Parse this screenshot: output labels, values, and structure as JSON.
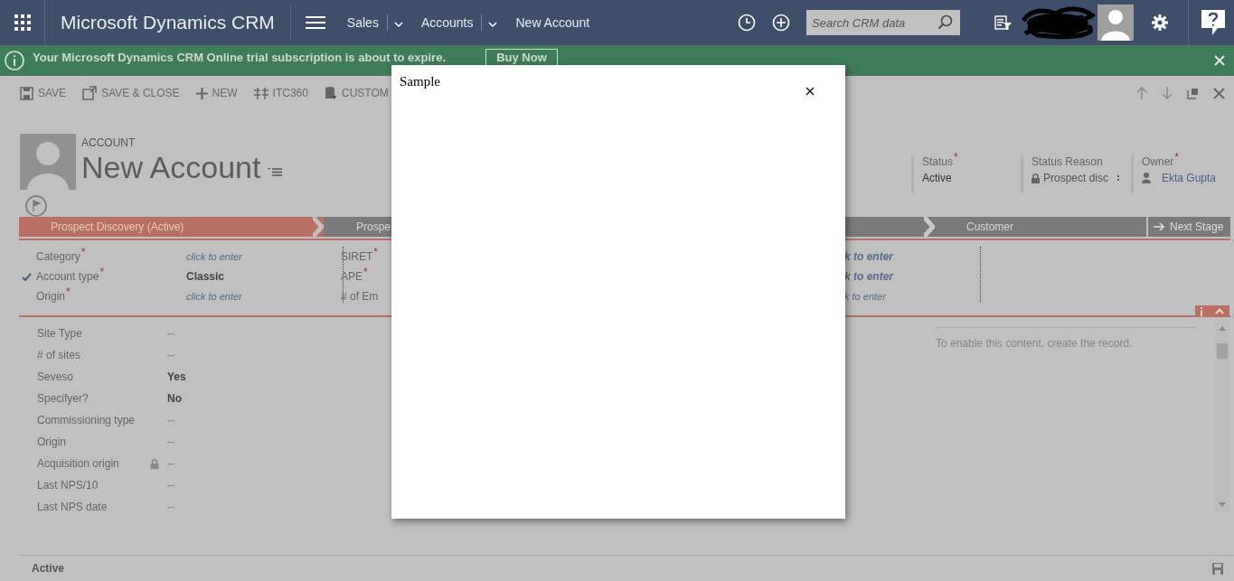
{
  "top_bar": {
    "app_title": "Microsoft Dynamics CRM",
    "breadcrumbs": [
      "Sales",
      "Accounts",
      "New Account"
    ],
    "search": {
      "placeholder": "Search CRM data"
    }
  },
  "notification": {
    "message": "Your Microsoft Dynamics CRM Online trial subscription is about to expire.",
    "button": "Buy Now"
  },
  "command_bar": [
    {
      "label": "SAVE",
      "kind": "save"
    },
    {
      "label": "SAVE & CLOSE",
      "kind": "save_close"
    },
    {
      "label": "NEW",
      "kind": "new"
    },
    {
      "label": "ITC360",
      "kind": "itc"
    },
    {
      "label": "CUSTOM",
      "kind": "custom"
    }
  ],
  "record": {
    "entity": "ACCOUNT",
    "name": "New Account",
    "header_fields": [
      {
        "label": "Status",
        "marker": "*",
        "value": "Active",
        "kind": "text"
      },
      {
        "label": "Status Reason",
        "value": "Prospect disc",
        "kind": "locked"
      },
      {
        "label": "Owner",
        "marker": "*",
        "value": "Ekta Gupta",
        "kind": "user"
      }
    ]
  },
  "process": {
    "stages": [
      {
        "label": "Prospect Discovery (Active)",
        "selected": true
      },
      {
        "label": "Prospe",
        "selected": false
      },
      {
        "label": "Customer",
        "selected": false
      }
    ],
    "next_button": "Next Stage"
  },
  "stage_fields": [
    {
      "label": "Category",
      "marker": "*",
      "value": "click to enter",
      "kind": "empty",
      "checked": false
    },
    {
      "label": "Account type",
      "marker": "*",
      "value": "Classic",
      "kind": "filled",
      "checked": true
    },
    {
      "label": "Origin",
      "marker": "*",
      "value": "click to enter",
      "kind": "empty",
      "checked": false
    }
  ],
  "stage_fields_2": [
    {
      "label": "SIRET",
      "marker": "*"
    },
    {
      "label": "APE",
      "marker": "*"
    },
    {
      "label": "# of Em"
    }
  ],
  "stage_fields_3": [
    {
      "value": "k to enter",
      "kind": "bold"
    },
    {
      "value": "k to enter",
      "kind": "bold"
    },
    {
      "value": "k to enter",
      "kind": "plain"
    }
  ],
  "details": [
    {
      "label": "Site Type",
      "value": "--",
      "locked": false,
      "kind": "plain"
    },
    {
      "label": "# of sites",
      "value": "--",
      "locked": false,
      "kind": "plain"
    },
    {
      "label": "Seveso",
      "value": "Yes",
      "locked": false,
      "kind": "bold"
    },
    {
      "label": "Specifyer?",
      "value": "No",
      "locked": false,
      "kind": "bold"
    },
    {
      "label": "Commissioning type",
      "value": "--",
      "locked": false,
      "kind": "plain"
    },
    {
      "label": "Origin",
      "value": "--",
      "locked": false,
      "kind": "plain"
    },
    {
      "label": "Acquisition origin",
      "value": "--",
      "locked": true,
      "kind": "plain"
    },
    {
      "label": "Last NPS/10",
      "value": "--",
      "locked": false,
      "kind": "plain"
    },
    {
      "label": "Last NPS date",
      "value": "--",
      "locked": false,
      "kind": "plain"
    }
  ],
  "side_panel": {
    "message": "To enable this content, create the record."
  },
  "status_bar": {
    "status": "Active"
  },
  "dialog": {
    "title": "Sample"
  }
}
